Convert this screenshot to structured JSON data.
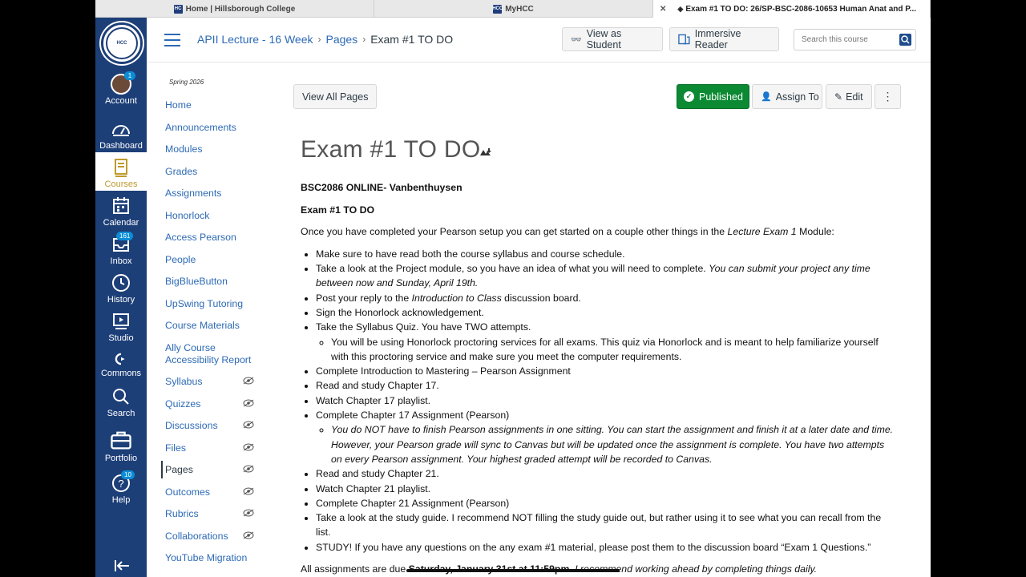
{
  "browser": {
    "tabs": [
      {
        "label": "Home | Hillsborough College",
        "favicon": "HC"
      },
      {
        "label": "MyHCC",
        "favicon": "HCC"
      },
      {
        "label": "Exam #1 TO DO: 26/SP-BSC-2086-10653 Human Anat and P...",
        "favicon": "canvas"
      }
    ]
  },
  "global_nav": {
    "logo_text": "HILLSBOROUGH COLLEGE",
    "items": [
      {
        "label": "Account",
        "badge": "1"
      },
      {
        "label": "Dashboard"
      },
      {
        "label": "Courses"
      },
      {
        "label": "Calendar"
      },
      {
        "label": "Inbox",
        "badge": "161"
      },
      {
        "label": "History"
      },
      {
        "label": "Studio"
      },
      {
        "label": "Commons"
      },
      {
        "label": "Search"
      },
      {
        "label": "Portfolio"
      },
      {
        "label": "Help",
        "badge": "10"
      }
    ]
  },
  "header": {
    "breadcrumb": [
      "APII Lecture - 16 Week",
      "Pages",
      "Exam #1 TO DO"
    ],
    "view_as_student": "View as Student",
    "immersive_reader": "Immersive Reader",
    "search_placeholder": "Search this course"
  },
  "course_nav": {
    "term": "Spring 2026",
    "items": [
      "Home",
      "Announcements",
      "Modules",
      "Grades",
      "Assignments",
      "Honorlock",
      "Access Pearson",
      "People",
      "BigBlueButton",
      "UpSwing Tutoring",
      "Course Materials",
      "Ally Course Accessibility Report",
      "Syllabus",
      "Quizzes",
      "Discussions",
      "Files",
      "Pages",
      "Outcomes",
      "Rubrics",
      "Collaborations",
      "YouTube Migration"
    ],
    "active": "Pages"
  },
  "toolbar": {
    "view_all_pages": "View All Pages",
    "published": "Published",
    "assign_to": "Assign To",
    "edit": "Edit",
    "more": "⋮"
  },
  "page": {
    "title": "Exam #1 TO DO",
    "course_line": "BSC2086 ONLINE- Vanbenthuysen",
    "heading": "Exam #1 TO DO",
    "intro_a": "Once you have completed your Pearson setup you can get started on a couple other things in the ",
    "intro_em": "Lecture Exam 1",
    "intro_b": " Module:",
    "b1": "Make sure to have read both the course syllabus and course schedule.",
    "b2a": "Take a look at the Project module, so you have an idea of what you will need to complete. ",
    "b2em": "You can submit your project any time between now and Sunday, April 19th.",
    "b3a": "Post your reply to the ",
    "b3em": "Introduction to Class",
    "b3b": " discussion board.",
    "b4": "Sign the Honorlock acknowledgement.",
    "b5": "Take the Syllabus Quiz. You have TWO attempts.",
    "b5sub": "You will be using Honorlock proctoring services for all exams.  This quiz via Honorlock and is meant to help familiarize yourself with this proctoring service and make sure you meet the computer requirements.",
    "b6": "Complete Introduction to Mastering – Pearson Assignment",
    "b7": "Read and study Chapter 17.",
    "b8": "Watch Chapter 17 playlist.",
    "b9": "Complete Chapter 17 Assignment (Pearson)",
    "b9sub": "You do NOT have to finish Pearson assignments in one sitting. You can start the assignment and finish it at a later date and time. However, your Pearson grade will sync to Canvas but will be updated once the assignment is complete. You have two attempts on every Pearson assignment.  Your highest graded attempt will be recorded to Canvas.",
    "b10": "Read and study Chapter 21.",
    "b11": "Watch Chapter 21 playlist.",
    "b12": "Complete Chapter 21 Assignment (Pearson)",
    "b13": "Take a look at the study guide. I recommend NOT filling the study guide out, but rather using it to see what you can recall from the list.",
    "b14": "STUDY! If you have any questions on the any exam #1 material, please post them to the discussion board “Exam 1 Questions.”",
    "footer_a": "All assignments are due ",
    "footer_b": "Saturday, January 31st at 11:59pm",
    "footer_c": ". I recommend working ahead by completing things daily."
  },
  "colors": {
    "nav_bg": "#1d3f78",
    "link": "#2d6ab5",
    "published": "#0b8a33",
    "courses_gold": "#bf9a2e"
  }
}
